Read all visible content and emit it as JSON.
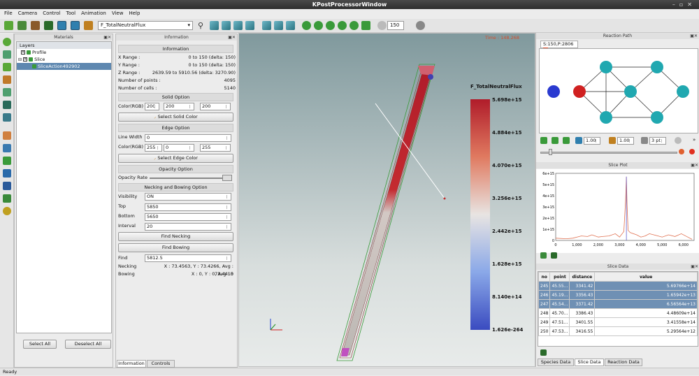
{
  "window": {
    "title": "KPostProcessorWindow"
  },
  "menu": [
    "File",
    "Camera",
    "Control",
    "Tool",
    "Animation",
    "View",
    "Help"
  ],
  "toolbar": {
    "field": "F_TotalNeutralFlux",
    "frame": "150"
  },
  "materials": {
    "panel_title": "Materials",
    "layers_header": "Layers",
    "items": [
      {
        "label": "Profile"
      },
      {
        "label": "Slice"
      },
      {
        "label": "SliceAction492902"
      }
    ],
    "select_all": "Select All",
    "deselect_all": "Deselect All"
  },
  "information": {
    "panel_title": "Information",
    "section_info": "Information",
    "rows": [
      {
        "label": "X Range :",
        "value": "0 to 150 (delta: 150)"
      },
      {
        "label": "Y Range :",
        "value": "0 to 150 (delta: 150)"
      },
      {
        "label": "Z Range :",
        "value": "2639.59 to 5910.56 (delta: 3270.90)"
      },
      {
        "label": "Number of points :",
        "value": "4095"
      },
      {
        "label": "Number of cells :",
        "value": "5140"
      }
    ],
    "solid_option": "Solid Option",
    "color_label": "Color(RGB)",
    "solid_rgb": [
      "200",
      "200",
      "200"
    ],
    "select_solid_color": "Select Solid Color",
    "edge_option": "Edge Option",
    "line_width_label": "Line Width",
    "line_width": "0",
    "edge_rgb": [
      "255",
      "0",
      "255"
    ],
    "select_edge_color": "Select Edge Color",
    "opacity_option": "Opacity Option",
    "opacity_rate_label": "Opacity Rate",
    "opacity_rate": 0.98,
    "necking_option": "Necking and Bowing Option",
    "visibility_label": "Visibility",
    "visibility": "ON",
    "top_label": "Top",
    "top": "5850",
    "bottom_label": "Bottom",
    "bottom": "5650",
    "interval_label": "Interval",
    "interval": "20",
    "find_necking": "Find Necking",
    "find_bowing": "Find Bowing",
    "find_label": "Find",
    "find_value": "5812.5",
    "necking_label": "Necking",
    "necking_value": "X : 73.4563, Y : 73.4266, Avg : 73.4415",
    "bowing_label": "Bowing",
    "bowing_value": "X : 0, Y : 0, Avg : 0",
    "tabs": [
      "Information",
      "Controls"
    ]
  },
  "viewport": {
    "time": "Time : 148.268",
    "legend_title": "F_TotalNeutralFlux",
    "legend_ticks": [
      "5.698e+15",
      "4.884e+15",
      "4.070e+15",
      "3.256e+15",
      "2.442e+15",
      "1.628e+15",
      "8.140e+14",
      "1.626e-264"
    ],
    "colors": {
      "high": "#b01c2a",
      "mid": "#e8e4e2",
      "low": "#3a4bc0"
    }
  },
  "reaction_path": {
    "panel_title": "Reaction Path",
    "tab": "S:150,P:2806",
    "spin1": "1.00",
    "spin2": "1.00",
    "spin3": "3 pt"
  },
  "slice_plot": {
    "panel_title": "Slice Plot",
    "chart_data": {
      "type": "line",
      "xlim": [
        0,
        6500
      ],
      "ylim": [
        0,
        6000000000000000.0
      ],
      "x_ticks": [
        "0",
        "1,000",
        "2,000",
        "3,000",
        "4,000",
        "5,000",
        "6,000"
      ],
      "y_ticks": [
        "6e+15",
        "5e+15",
        "4e+15",
        "3e+15",
        "2e+15",
        "1e+15",
        "0"
      ],
      "series": [
        {
          "values_x": [
            0,
            500,
            800,
            1000,
            1200,
            1500,
            1700,
            2000,
            2200,
            2500,
            2800,
            3000,
            3200,
            3280,
            3320,
            3350,
            3400,
            3500,
            3800,
            4000,
            4200,
            4400,
            4700,
            5000,
            5300,
            5600,
            5900,
            6200,
            6400
          ],
          "values_y": [
            200000000000000.0,
            150000000000000.0,
            200000000000000.0,
            300000000000000.0,
            400000000000000.0,
            350000000000000.0,
            500000000000000.0,
            300000000000000.0,
            350000000000000.0,
            400000000000000.0,
            600000000000000.0,
            300000000000000.0,
            800000000000000.0,
            3500000000000000.0,
            5700000000000000.0,
            3200000000000000.0,
            900000000000000.0,
            700000000000000.0,
            500000000000000.0,
            300000000000000.0,
            400000000000000.0,
            600000000000000.0,
            450000000000000.0,
            300000000000000.0,
            500000000000000.0,
            350000000000000.0,
            600000000000000.0,
            300000000000000.0,
            100000000000000.0
          ]
        }
      ]
    }
  },
  "slice_data": {
    "panel_title": "Slice Data",
    "headers": [
      "no",
      "point",
      "distance",
      "value"
    ],
    "rows": [
      {
        "no": "245",
        "point": "45.55...",
        "distance": "3341.42",
        "value": "5.69766e+14",
        "sel": true
      },
      {
        "no": "246",
        "point": "45.19...",
        "distance": "3356.43",
        "value": "1.65942e+13",
        "sel": true
      },
      {
        "no": "247",
        "point": "45.54...",
        "distance": "3371.42",
        "value": "6.56564e+13",
        "sel": true
      },
      {
        "no": "248",
        "point": "45.70...",
        "distance": "3386.43",
        "value": "4.48609e+14",
        "sel": false
      },
      {
        "no": "249",
        "point": "47.51...",
        "distance": "3401.55",
        "value": "3.41558e+14",
        "sel": false
      },
      {
        "no": "250",
        "point": "47.53...",
        "distance": "3416.55",
        "value": "5.29564e+12",
        "sel": false
      }
    ],
    "tabs": [
      "Species Data",
      "Slice Data",
      "Reaction Data"
    ]
  },
  "status": "Ready"
}
